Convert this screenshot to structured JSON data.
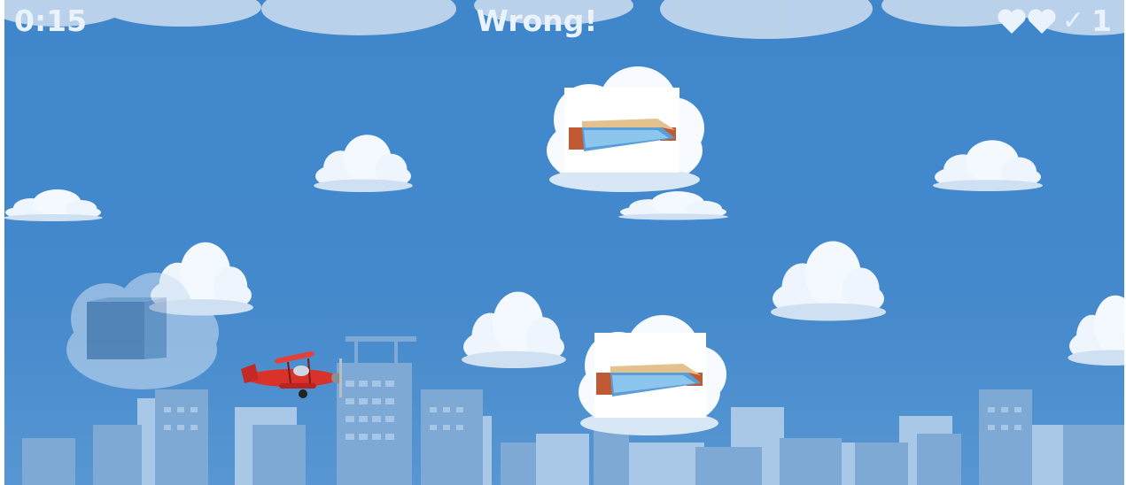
{
  "hud": {
    "timer": "0:15",
    "status": "Wrong!",
    "lives": 2,
    "score_check": "✓",
    "score": "1"
  },
  "answers": [
    {
      "icon": "swimming-pool-icon"
    },
    {
      "icon": "swimming-pool-icon"
    },
    {
      "icon": "building-block-icon"
    }
  ],
  "player": {
    "icon": "red-biplane-icon"
  },
  "colors": {
    "sky": "#4489cc",
    "city_back": "#a9c8e8",
    "city_front": "#7ea9d4",
    "plane": "#d9322a",
    "hud_text": "#eaf2fb"
  }
}
